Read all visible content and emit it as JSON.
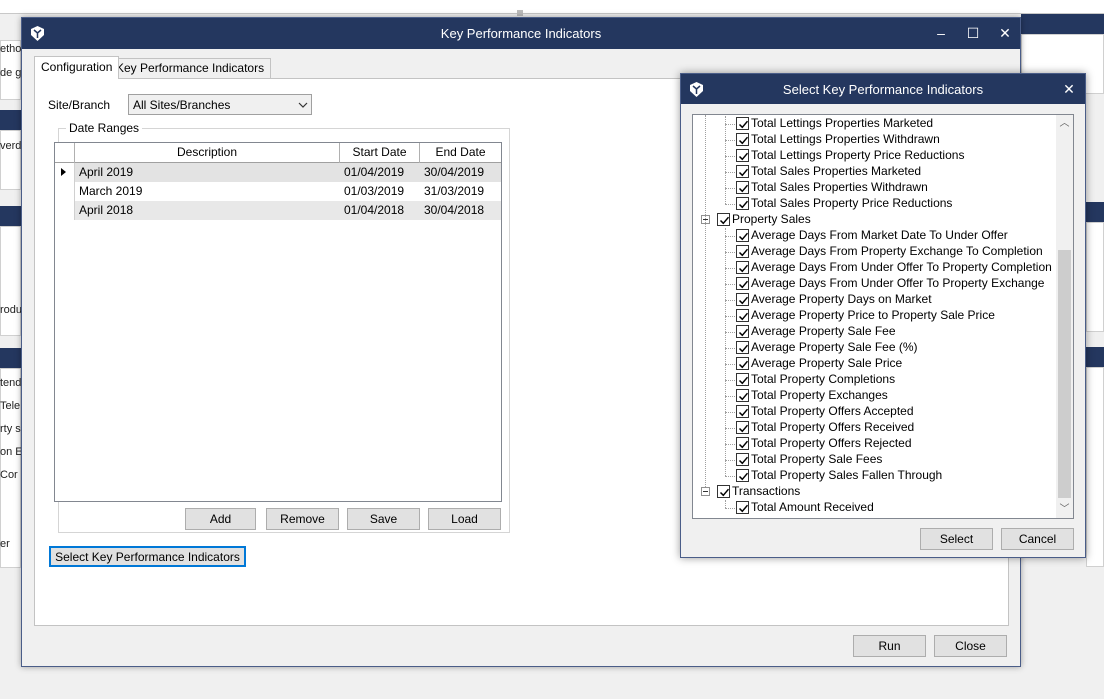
{
  "background": {
    "fragments": [
      "ethod",
      "de g",
      "verd",
      "rodu",
      "tend",
      "Tele",
      "rty s",
      "on E",
      "Cor",
      "er"
    ]
  },
  "main_dialog": {
    "title": "Key Performance Indicators",
    "controls": {
      "minimize": "–",
      "maximize": "☐",
      "close": "✕"
    },
    "tabs": [
      {
        "label": "Configuration",
        "active": true
      },
      {
        "label": "Key Performance Indicators",
        "active": false
      }
    ],
    "site_branch": {
      "label": "Site/Branch",
      "value": "All Sites/Branches"
    },
    "date_ranges": {
      "title": "Date Ranges",
      "columns": [
        "Description",
        "Start Date",
        "End Date"
      ],
      "rows": [
        {
          "description": "April 2019",
          "start": "01/04/2019",
          "end": "30/04/2019",
          "selected": true
        },
        {
          "description": "March 2019",
          "start": "01/03/2019",
          "end": "31/03/2019",
          "selected": false
        },
        {
          "description": "April 2018",
          "start": "01/04/2018",
          "end": "30/04/2018",
          "selected": false
        }
      ],
      "buttons": {
        "add": "Add",
        "remove": "Remove",
        "save": "Save",
        "load": "Load"
      }
    },
    "select_kpi_button": "Select Key Performance Indicators",
    "footer": {
      "run": "Run",
      "close": "Close"
    }
  },
  "popup": {
    "title": "Select Key Performance Indicators",
    "close": "✕",
    "tree": [
      {
        "label": "Total Lettings Properties Marketed",
        "level": 1,
        "checked": true
      },
      {
        "label": "Total Lettings Properties Withdrawn",
        "level": 1,
        "checked": true
      },
      {
        "label": "Total Lettings Property Price Reductions",
        "level": 1,
        "checked": true
      },
      {
        "label": "Total Sales Properties Marketed",
        "level": 1,
        "checked": true
      },
      {
        "label": "Total Sales Properties Withdrawn",
        "level": 1,
        "checked": true
      },
      {
        "label": "Total Sales Property Price Reductions",
        "level": 1,
        "checked": true
      },
      {
        "label": "Property Sales",
        "level": 0,
        "checked": true,
        "expanded": true
      },
      {
        "label": "Average Days From Market Date To Under Offer",
        "level": 1,
        "checked": true
      },
      {
        "label": "Average Days From Property Exchange To Completion",
        "level": 1,
        "checked": true
      },
      {
        "label": "Average Days From Under Offer To Property Completion",
        "level": 1,
        "checked": true
      },
      {
        "label": "Average Days From Under Offer To Property Exchange",
        "level": 1,
        "checked": true
      },
      {
        "label": "Average Property Days on Market",
        "level": 1,
        "checked": true
      },
      {
        "label": "Average Property Price to Property Sale Price",
        "level": 1,
        "checked": true
      },
      {
        "label": "Average Property Sale Fee",
        "level": 1,
        "checked": true
      },
      {
        "label": "Average Property Sale Fee (%)",
        "level": 1,
        "checked": true
      },
      {
        "label": "Average Property Sale Price",
        "level": 1,
        "checked": true
      },
      {
        "label": "Total Property Completions",
        "level": 1,
        "checked": true
      },
      {
        "label": "Total Property Exchanges",
        "level": 1,
        "checked": true
      },
      {
        "label": "Total Property Offers Accepted",
        "level": 1,
        "checked": true
      },
      {
        "label": "Total Property Offers Received",
        "level": 1,
        "checked": true
      },
      {
        "label": "Total Property Offers Rejected",
        "level": 1,
        "checked": true
      },
      {
        "label": "Total Property Sale Fees",
        "level": 1,
        "checked": true
      },
      {
        "label": "Total Property Sales Fallen Through",
        "level": 1,
        "checked": true
      },
      {
        "label": "Transactions",
        "level": 0,
        "checked": true,
        "expanded": true
      },
      {
        "label": "Total Amount Received",
        "level": 1,
        "checked": true
      }
    ],
    "buttons": {
      "select": "Select",
      "cancel": "Cancel"
    }
  },
  "colors": {
    "titlebar": "#24375f",
    "focus": "#0078d7"
  }
}
